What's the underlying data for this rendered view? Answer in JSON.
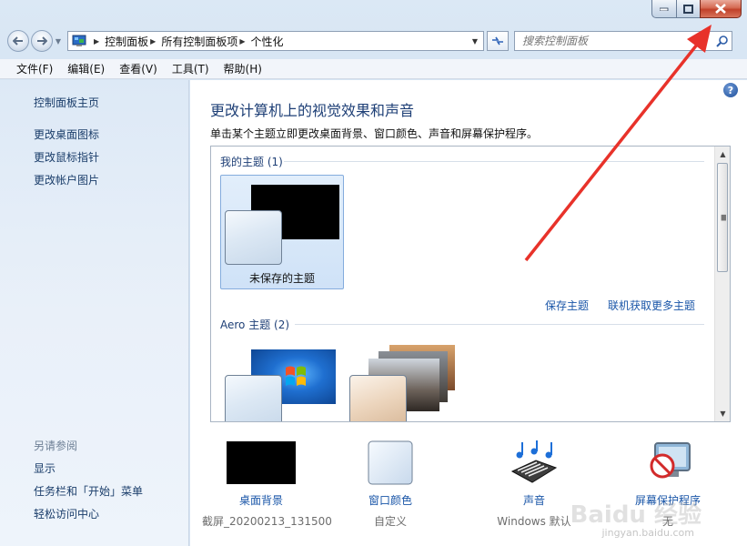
{
  "window": {
    "caption_buttons": [
      "minimize",
      "maximize",
      "close"
    ]
  },
  "address_bar": {
    "crumbs": [
      "控制面板",
      "所有控制面板项",
      "个性化"
    ]
  },
  "search": {
    "placeholder": "搜索控制面板"
  },
  "menu": {
    "items": [
      "文件(F)",
      "编辑(E)",
      "查看(V)",
      "工具(T)",
      "帮助(H)"
    ]
  },
  "sidebar": {
    "home": "控制面板主页",
    "links": [
      "更改桌面图标",
      "更改鼠标指针",
      "更改帐户图片"
    ],
    "see_also_heading": "另请参阅",
    "see_also": [
      "显示",
      "任务栏和「开始」菜单",
      "轻松访问中心"
    ]
  },
  "main": {
    "title": "更改计算机上的视觉效果和声音",
    "description": "单击某个主题立即更改桌面背景、窗口颜色、声音和屏幕保护程序。",
    "help_glyph": "?"
  },
  "themes": {
    "my_group_title": "我的主题 (1)",
    "unsaved_theme_label": "未保存的主题",
    "save_theme_link": "保存主题",
    "get_more_link": "联机获取更多主题",
    "aero_group_title": "Aero 主题 (2)"
  },
  "bottom": {
    "items": [
      {
        "label": "桌面背景",
        "sub": "截屏_20200213_131500",
        "icon": "desktop-background-icon"
      },
      {
        "label": "窗口颜色",
        "sub": "自定义",
        "icon": "window-color-icon"
      },
      {
        "label": "声音",
        "sub": "Windows 默认",
        "icon": "sound-icon"
      },
      {
        "label": "屏幕保护程序",
        "sub": "无",
        "icon": "screensaver-icon"
      }
    ]
  },
  "overlay": {
    "watermark": "Baidu 经验",
    "watermark_sub": "jingyan.baidu.com",
    "arrow_color": "#e8322a"
  },
  "colors": {
    "link": "#1a56a8",
    "heading": "#1e3f76",
    "selected_tile": "#cfe2f7",
    "close_button": "#c0412a"
  }
}
